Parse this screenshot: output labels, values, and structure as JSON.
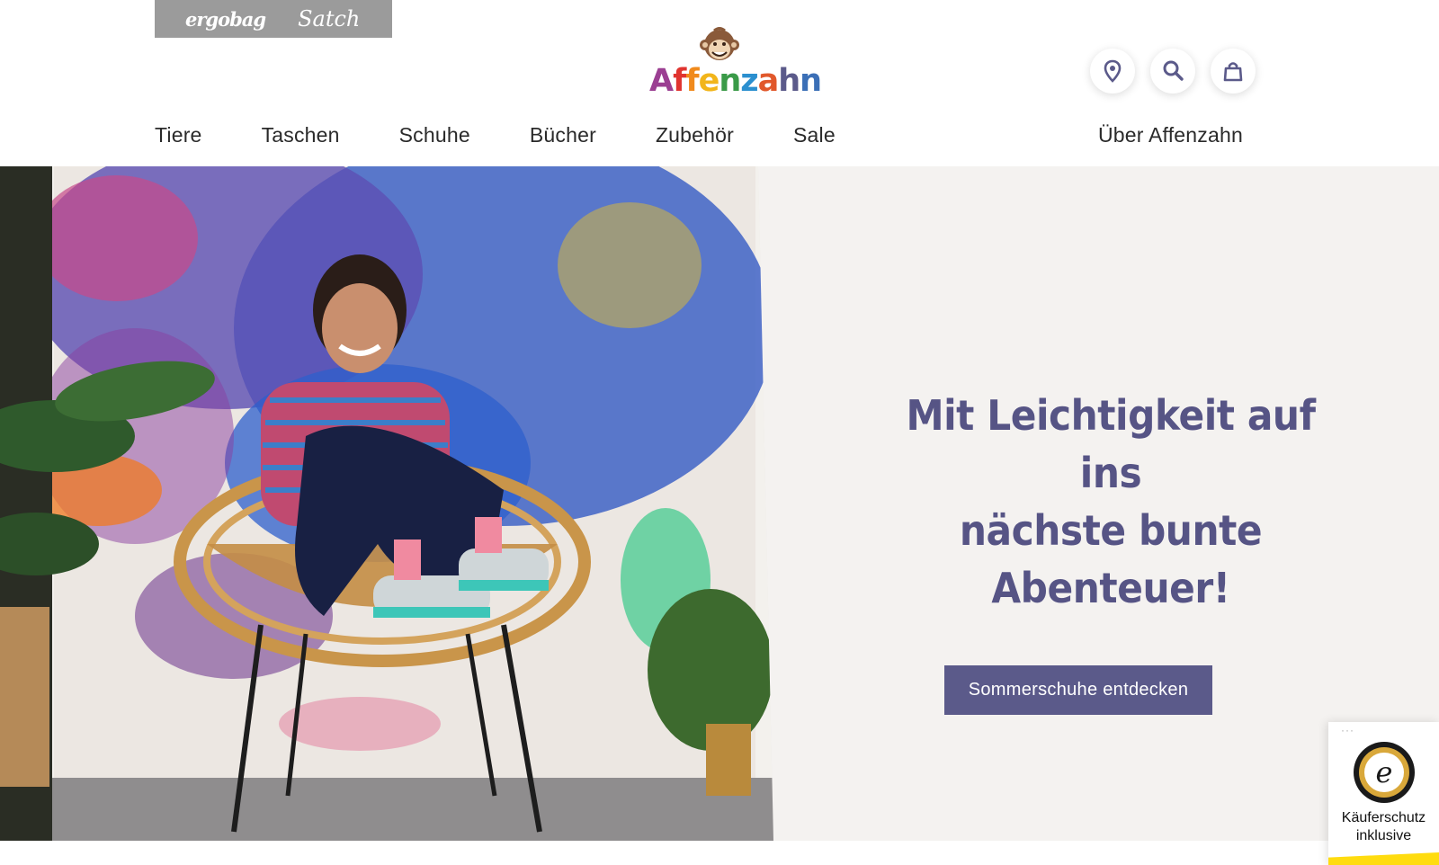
{
  "brand_bar": {
    "items": [
      "ergobag",
      "Satch"
    ]
  },
  "logo": {
    "text": "Affenzahn",
    "letters": [
      {
        "ch": "A",
        "color": "#9b3f92"
      },
      {
        "ch": "f",
        "color": "#e0342f"
      },
      {
        "ch": "f",
        "color": "#f08a1c"
      },
      {
        "ch": "e",
        "color": "#f2b51a"
      },
      {
        "ch": "n",
        "color": "#3a9a48"
      },
      {
        "ch": "z",
        "color": "#2b8fcf"
      },
      {
        "ch": "a",
        "color": "#e1582b"
      },
      {
        "ch": "h",
        "color": "#5b5a8a"
      },
      {
        "ch": "n",
        "color": "#3b6fb6"
      }
    ]
  },
  "header_icons": [
    "location-pin-icon",
    "search-icon",
    "shopping-bag-icon"
  ],
  "nav": {
    "items": [
      "Tiere",
      "Taschen",
      "Schuhe",
      "Bücher",
      "Zubehör",
      "Sale"
    ],
    "about": "Über Affenzahn"
  },
  "hero": {
    "title_line1": "Mit Leichtigkeit auf ins",
    "title_line2": "nächste bunte Abenteuer!",
    "cta_label": "Sommerschuhe entdecken",
    "accent_color": "#5b5a8a"
  },
  "trusted_badge": {
    "dots": "···",
    "label_line1": "Käuferschutz",
    "label_line2": "inklusive"
  }
}
